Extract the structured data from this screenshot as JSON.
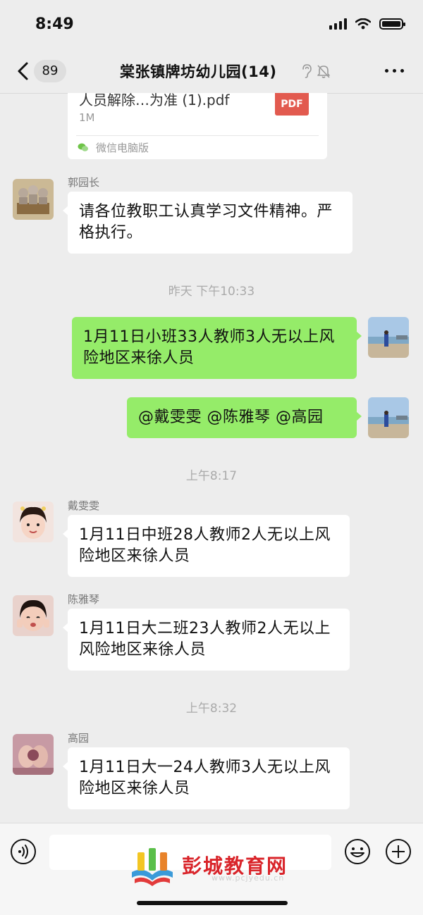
{
  "status_bar": {
    "time": "8:49"
  },
  "header": {
    "unread_count": "89",
    "title": "棠张镇牌坊幼儿园(14)"
  },
  "file_card": {
    "name": "人员解除…为准 (1).pdf",
    "type_label": "PDF",
    "size": "1M",
    "source": "微信电脑版"
  },
  "messages": [
    {
      "sender": "郭园长",
      "text": "请各位教职工认真学习文件精神。严格执行。"
    },
    {
      "timestamp": "昨天 下午10:33"
    },
    {
      "text": "1月11日小班33人教师3人无以上风险地区来徐人员"
    },
    {
      "text": "@戴雯雯 @陈雅琴 @高园"
    },
    {
      "timestamp": "上午8:17"
    },
    {
      "sender": "戴雯雯",
      "text": "1月11日中班28人教师2人无以上风险地区来徐人员"
    },
    {
      "sender": "陈雅琴",
      "text": "1月11日大二班23人教师2人无以上风险地区来徐人员"
    },
    {
      "timestamp": "上午8:32"
    },
    {
      "sender": "高园",
      "text": "1月11日大一24人教师3人无以上风险地区来徐人员"
    }
  ],
  "watermark": {
    "name": "彭城教育网",
    "url": "www.pcjyedu.cn"
  },
  "colors": {
    "outgoing_bubble": "#95ec69",
    "incoming_bubble": "#ffffff",
    "background": "#ededed"
  }
}
